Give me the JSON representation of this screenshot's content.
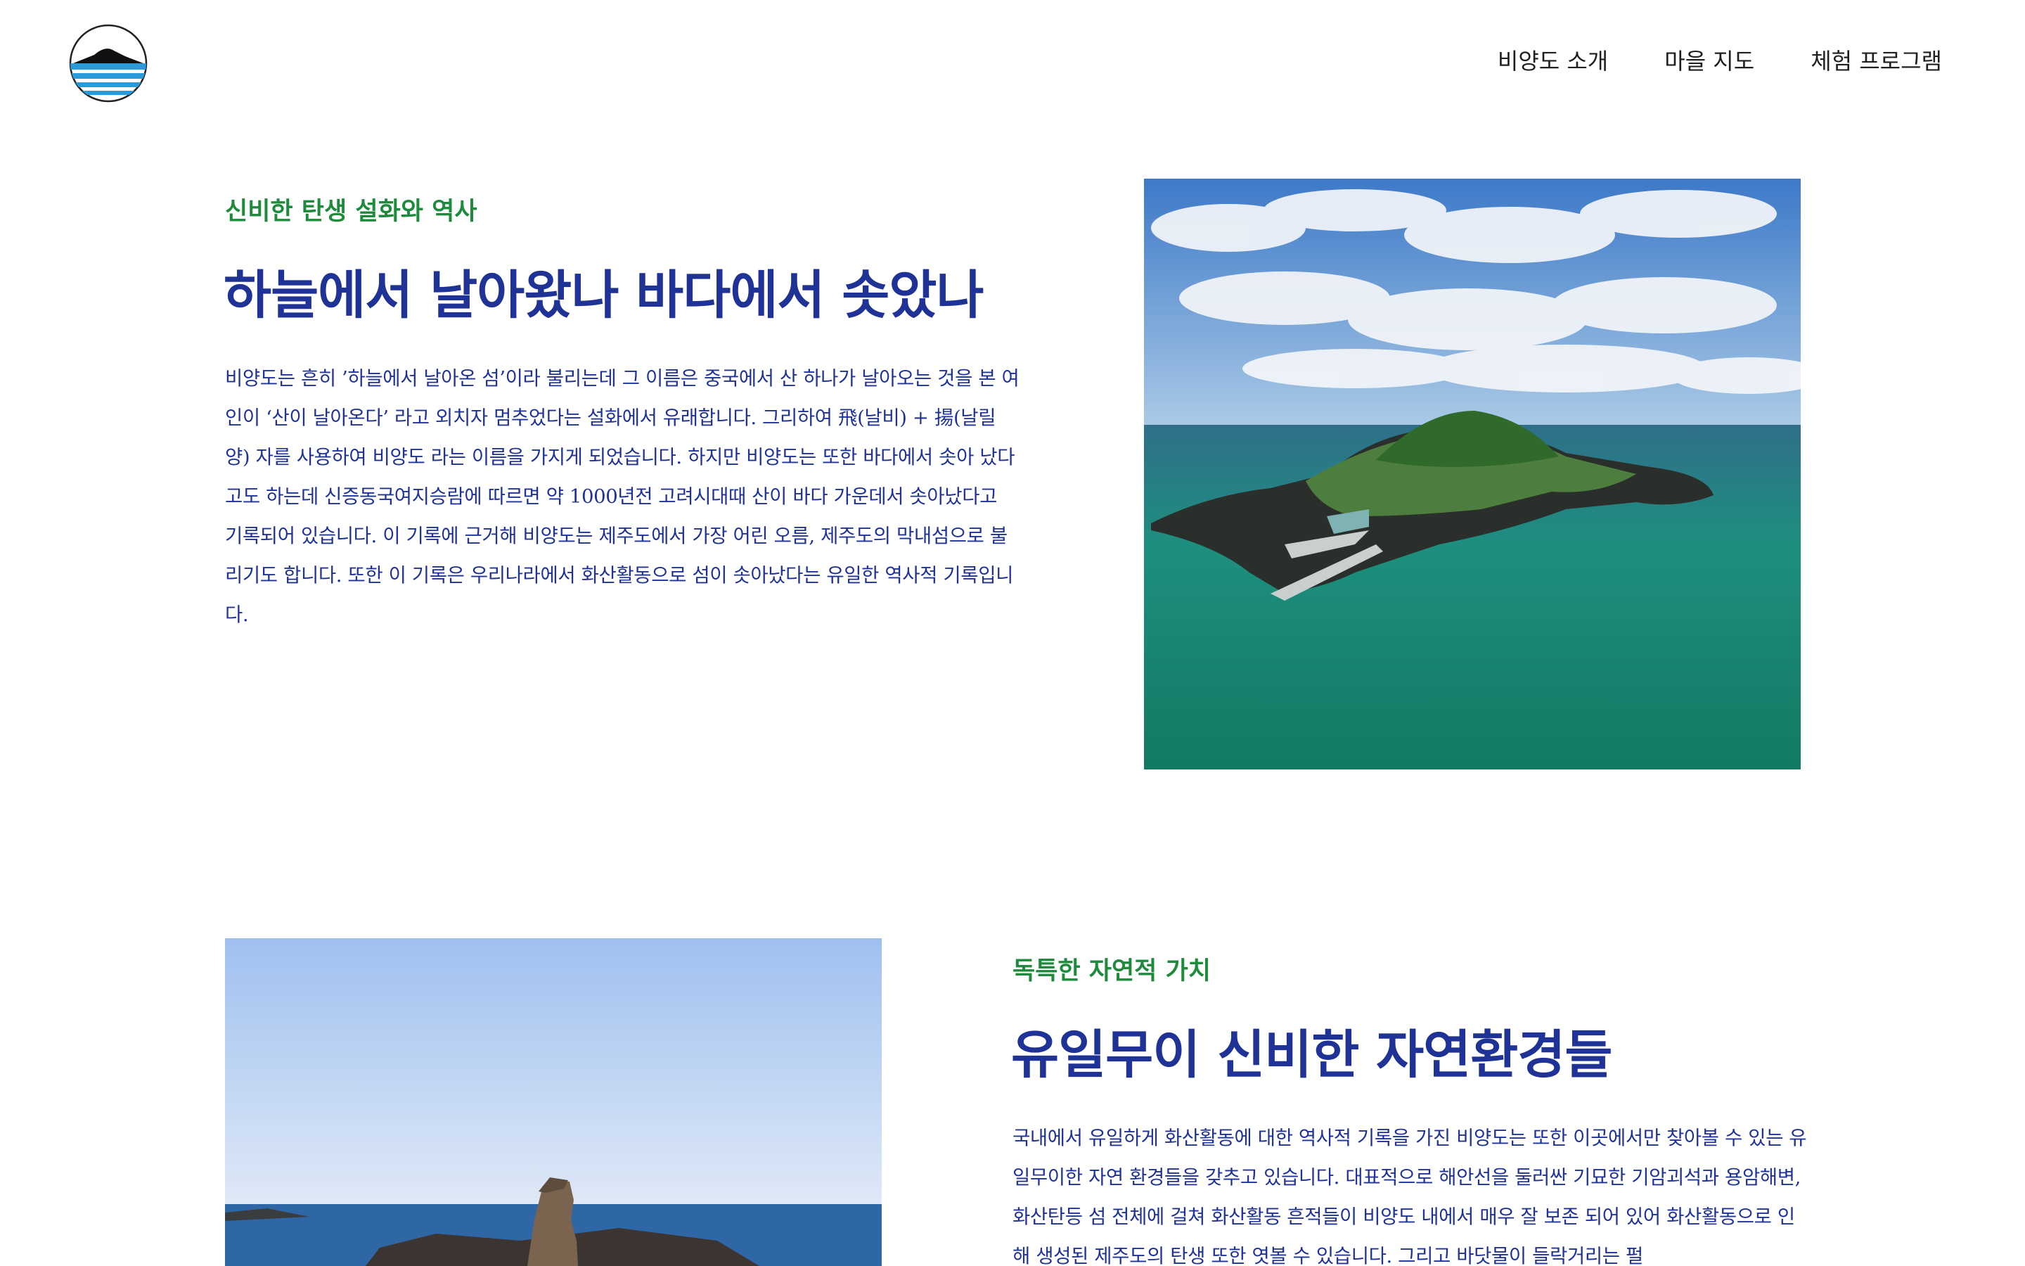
{
  "header": {
    "nav": [
      {
        "label": "비양도 소개"
      },
      {
        "label": "마을 지도"
      },
      {
        "label": "체험 프로그램"
      }
    ]
  },
  "section1": {
    "eyebrow": "신비한 탄생 설화와 역사",
    "title": "하늘에서 날아왔나 바다에서 솟았나",
    "body": "비양도는 흔히 ’하늘에서 날아온 섬’이라 불리는데 그 이름은 중국에서 산 하나가 날아오는 것을 본 여인이 ‘산이 날아온다’ 라고 외치자 멈추었다는 설화에서 유래합니다. 그리하여 飛(날비) + 揚(날릴양) 자를 사용하여 비양도 라는 이름을 가지게 되었습니다. 하지만 비양도는 또한 바다에서 솟아 났다고도 하는데 신증동국여지승람에 따르면 약 1000년전 고려시대때 산이 바다 가운데서 솟아났다고 기록되어 있습니다. 이 기록에 근거해 비양도는 제주도에서 가장 어린 오름, 제주도의 막내섬으로 불리기도 합니다. 또한 이 기록은 우리나라에서 화산활동으로 섬이 솟아났다는 유일한 역사적 기록입니다."
  },
  "section2": {
    "eyebrow": "독특한 자연적 가치",
    "title": "유일무이 신비한 자연환경들",
    "body": "국내에서 유일하게 화산활동에 대한 역사적 기록을 가진 비양도는 또한 이곳에서만 찾아볼 수 있는 유일무이한 자연 환경들을 갖추고 있습니다. 대표적으로 해안선을 둘러싼 기묘한 기암괴석과 용암해변, 화산탄등 섬 전체에 걸쳐 화산활동 흔적들이 비양도 내에서 매우 잘 보존 되어 있어 화산활동으로 인해 생성된 제주도의 탄생 또한 엿볼 수 있습니다. 그리고 바닷물이 들락거리는 펄"
  },
  "colors": {
    "accent_green": "#1e8a3c",
    "text_blue": "#1f3296",
    "logo_blue": "#2a9bd8"
  },
  "icons": {
    "logo": "island-logo-icon"
  }
}
